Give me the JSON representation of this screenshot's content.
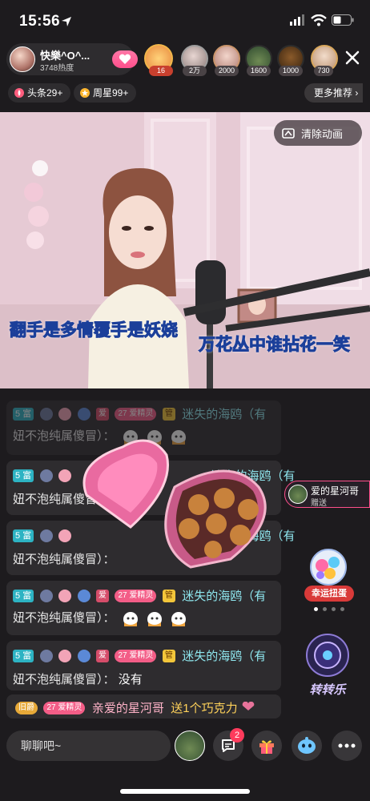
{
  "status_bar": {
    "time": "15:56"
  },
  "host": {
    "name": "快樂^O^...",
    "heat": "3748热度"
  },
  "rank_badges": [
    "16",
    "2万",
    "2000",
    "1600",
    "1000",
    "730"
  ],
  "chips": {
    "headline": "头条29+",
    "weekly_star": "周星99+",
    "more": "更多推荐"
  },
  "video": {
    "clear_animation": "清除动画",
    "lyric_left": "翻手是多情覆手是妖娆",
    "lyric_right": "万花丛中谁拈花一笑"
  },
  "chat": {
    "messages": [
      {
        "level": "5 富",
        "tag": "27 爱精灵",
        "tag_short": "爱",
        "gold": "管",
        "user": "迷失的海鸥（有",
        "text": "妞不泡纯属傻冒）："
      },
      {
        "level": "5 富",
        "user": "迷失的海鸥（有",
        "text": "妞不泡纯属傻冒）："
      },
      {
        "level": "5 富",
        "user": "迷失的海鸥（有",
        "text": "妞不泡纯属傻冒）："
      },
      {
        "level": "5 富",
        "tag": "27 爱精灵",
        "tag_short": "爱",
        "gold": "管",
        "user": "迷失的海鸥（有",
        "text": "妞不泡纯属傻冒）："
      },
      {
        "level": "5 富",
        "tag": "27 爱精灵",
        "tag_short": "爱",
        "gold": "管",
        "user": "迷失的海鸥（有",
        "text": "妞不泡纯属傻冒）：",
        "reply": "没有"
      }
    ],
    "gift_line": {
      "badge": "旧爵",
      "tag": "27 爱精灵",
      "user": "亲爱的星河哥",
      "action": "送1个巧克力"
    }
  },
  "gift_notice": {
    "user": "爱的星河哥",
    "action": "赠送"
  },
  "side": {
    "lucky_egg": "幸运扭蛋",
    "spin": "转转乐"
  },
  "bottom": {
    "placeholder": "聊聊吧~",
    "message_count": "2"
  },
  "colors": {
    "accent": "#ff4f8c",
    "username": "#8fe7ef",
    "lyric": "#4fb8ff"
  }
}
